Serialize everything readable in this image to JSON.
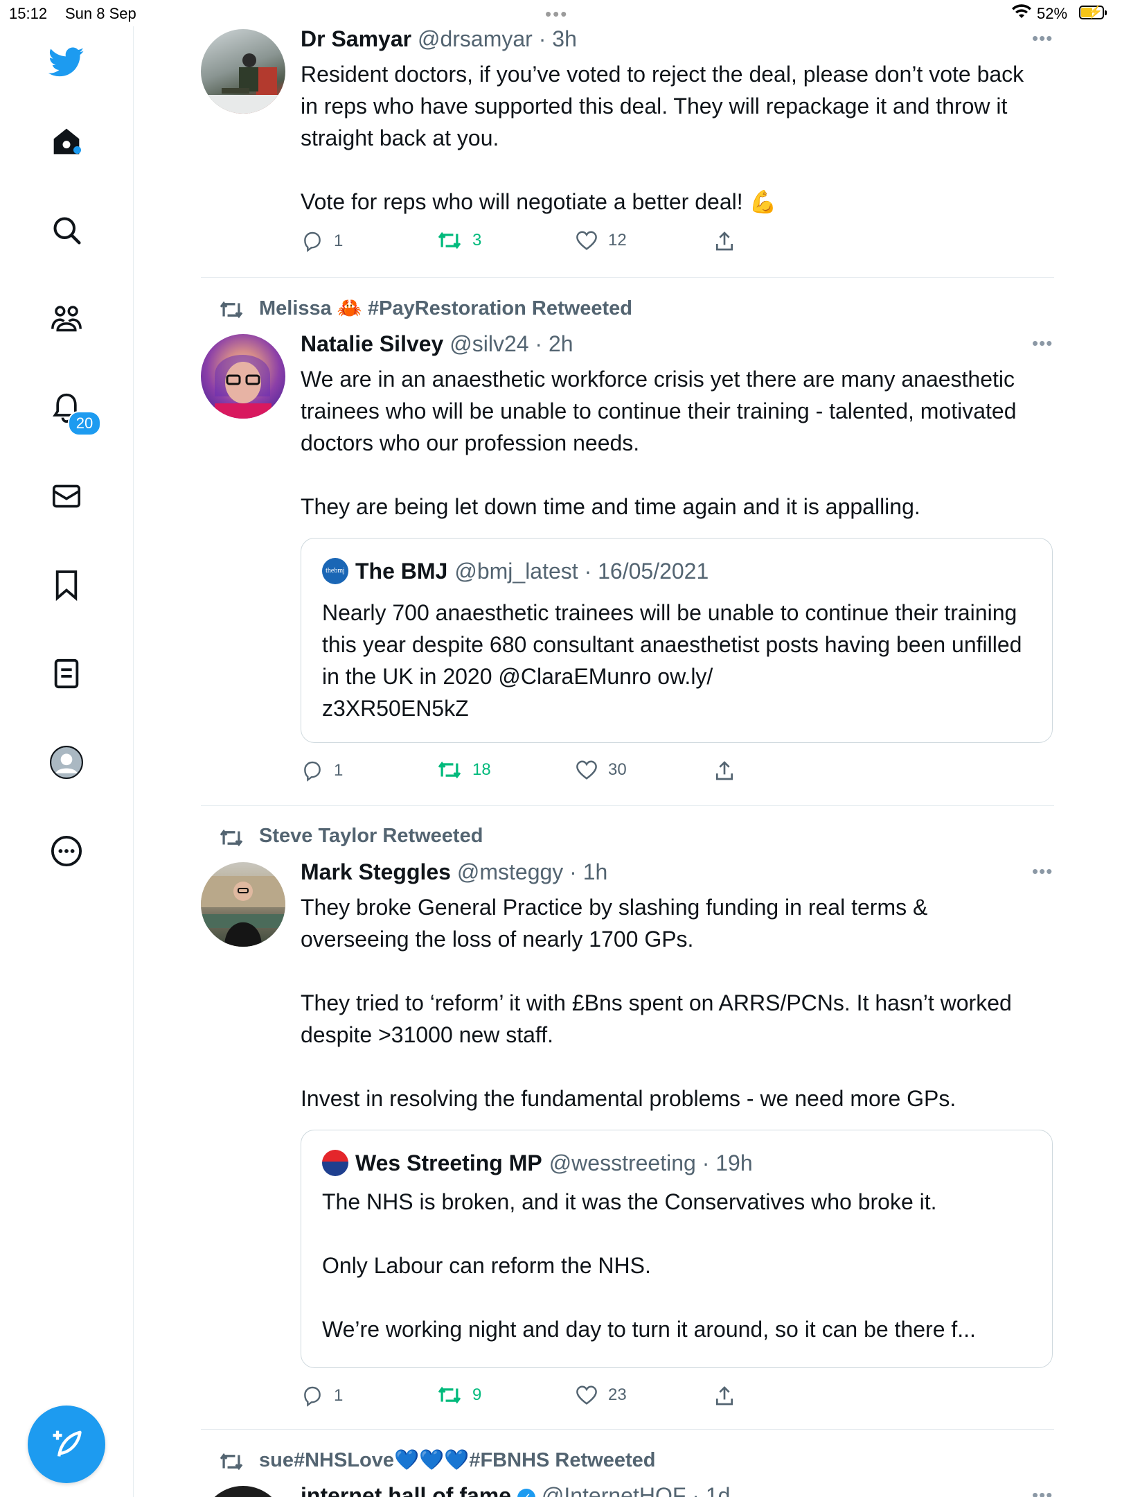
{
  "status_bar": {
    "time": "15:12",
    "date": "Sun 8 Sep",
    "battery": "52%"
  },
  "sidebar": {
    "notification_count": "20",
    "items": [
      {
        "icon": "twitter-bird-icon"
      },
      {
        "icon": "home-icon"
      },
      {
        "icon": "search-icon"
      },
      {
        "icon": "communities-icon"
      },
      {
        "icon": "notifications-icon"
      },
      {
        "icon": "messages-icon"
      },
      {
        "icon": "bookmarks-icon"
      },
      {
        "icon": "lists-icon"
      },
      {
        "icon": "profile-icon"
      },
      {
        "icon": "more-icon"
      }
    ],
    "compose_icon": "compose-tweet-icon"
  },
  "colors": {
    "accent": "#1d9bf0",
    "retweet_green": "#00ba7c",
    "secondary_text": "#536471"
  },
  "tweets": [
    {
      "retweeted_by": "",
      "name": "Dr Samyar",
      "meta": "@drsamyar · 3h",
      "body": "Resident doctors, if you’ve voted to reject the deal, please don’t vote back in reps who have supported this deal. They will repackage it and throw it straight back at you.\n\nVote for reps who will negotiate a better deal! 💪",
      "replies": "1",
      "retweets": "3",
      "likes": "12"
    },
    {
      "retweeted_by": "Melissa 🦀 #PayRestoration Retweeted",
      "name": "Natalie Silvey",
      "meta": "@silv24 · 2h",
      "body": "We are in an anaesthetic workforce crisis yet there are many anaesthetic trainees who will be unable to continue their training - talented, motivated doctors who our profession needs.\n\nThey are being let down time and time again and it is appalling.",
      "quote": {
        "avatar_text": "thebmj",
        "name": "The BMJ",
        "meta": "@bmj_latest · 16/05/2021",
        "body": "Nearly 700 anaesthetic trainees will be unable to continue their training this year despite 680 consultant anaesthetist posts having been unfilled in the UK in 2020 @ClaraEMunro ow.ly/\nz3XR50EN5kZ"
      },
      "replies": "1",
      "retweets": "18",
      "likes": "30"
    },
    {
      "retweeted_by": "Steve Taylor Retweeted",
      "name": "Mark Steggles",
      "meta": "@msteggy · 1h",
      "body": "They broke General Practice by slashing funding in real terms & overseeing the loss of nearly 1700 GPs.\n\nThey tried to ‘reform’ it with £Bns spent on ARRS/PCNs. It hasn’t worked despite >31000 new staff.\n\nInvest in resolving the fundamental problems - we need more GPs.",
      "quote": {
        "avatar_text": "",
        "name": "Wes Streeting MP",
        "meta": "@wesstreeting · 19h",
        "body": "The NHS is broken, and it was the Conservatives who broke it.\n\nOnly Labour can reform the NHS.\n\nWe’re working night and day to turn it around, so it can be there f..."
      },
      "replies": "1",
      "retweets": "9",
      "likes": "23"
    },
    {
      "retweeted_by": "sue#NHSLove💙💙💙#FBNHS Retweeted",
      "name": "internet hall of fame",
      "meta": "@InternetHOF · 1d"
    }
  ]
}
